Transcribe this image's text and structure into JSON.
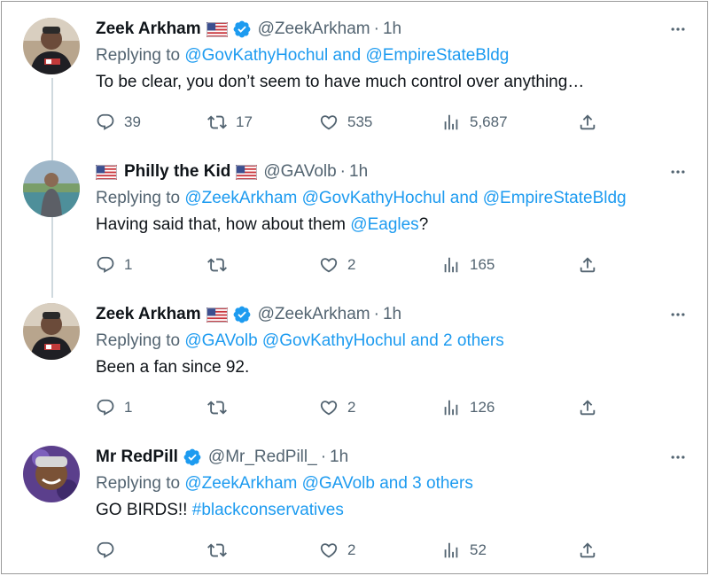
{
  "colors": {
    "link": "#1d9bf0",
    "muted": "#536471",
    "text": "#0f1419",
    "verified": "#1d9bf0",
    "thread_line": "#cfd9de"
  },
  "tweets": [
    {
      "name": "Zeek Arkham",
      "handle": "@ZeekArkham",
      "separator": "·",
      "time": "1h",
      "replying_prefix": "Replying to",
      "replying_links": "@GovKathyHochul and @EmpireStateBldg",
      "text": "To be clear, you don’t seem to have much control over anything…",
      "replies": "39",
      "retweets": "17",
      "likes": "535",
      "views": "5,687",
      "icons": [
        "us-flag-icon",
        "verified-badge-icon"
      ]
    },
    {
      "name": "Philly the Kid",
      "handle": "@GAVolb",
      "separator": "·",
      "time": "1h",
      "replying_prefix": "Replying to",
      "replying_links": "@ZeekArkham @GovKathyHochul and @EmpireStateBldg",
      "text_before": "Having said that, how about them ",
      "text_link": "@Eagles",
      "text_after": "?",
      "replies": "1",
      "retweets": "",
      "likes": "2",
      "views": "165",
      "icons": [
        "us-flag-icon",
        "us-flag-icon"
      ]
    },
    {
      "name": "Zeek Arkham",
      "handle": "@ZeekArkham",
      "separator": "·",
      "time": "1h",
      "replying_prefix": "Replying to",
      "replying_links": "@GAVolb @GovKathyHochul and 2 others",
      "text": "Been a fan since 92.",
      "replies": "1",
      "retweets": "",
      "likes": "2",
      "views": "126",
      "icons": [
        "us-flag-icon",
        "verified-badge-icon"
      ]
    },
    {
      "name": "Mr RedPill",
      "handle": "@Mr_RedPill_",
      "separator": "·",
      "time": "1h",
      "replying_prefix": "Replying to",
      "replying_links": "@ZeekArkham @GAVolb and 3 others",
      "text_before": "GO BIRDS!! ",
      "text_link": "#blackconservatives",
      "replies": "",
      "retweets": "",
      "likes": "2",
      "views": "52",
      "icons": [
        "verified-badge-icon"
      ]
    }
  ]
}
